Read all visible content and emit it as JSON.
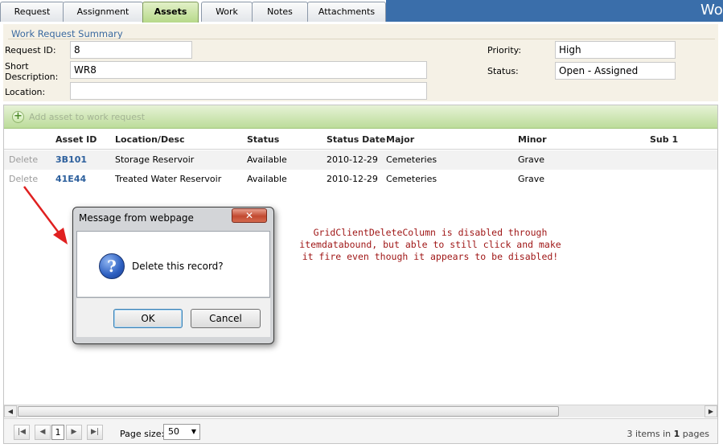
{
  "app": {
    "title": "Work Request"
  },
  "tabs": [
    {
      "label": "Request",
      "active": false
    },
    {
      "label": "Assignment",
      "active": false
    },
    {
      "label": "Assets",
      "active": true
    },
    {
      "label": "Work",
      "active": false
    },
    {
      "label": "Notes",
      "active": false
    },
    {
      "label": "Attachments",
      "active": false
    }
  ],
  "summary": {
    "legend": "Work Request Summary",
    "request_id_label": "Request ID:",
    "request_id_value": "8",
    "short_desc_label_1": "Short",
    "short_desc_label_2": "Description:",
    "short_desc_value": "WR8",
    "location_label": "Location:",
    "location_value": "",
    "priority_label": "Priority:",
    "priority_value": "High",
    "status_label": "Status:",
    "status_value": "Open - Assigned"
  },
  "grid": {
    "add_label": "Add asset to work request",
    "columns": [
      "Asset ID",
      "Location/Desc",
      "Status",
      "Status Date",
      "Major",
      "Minor",
      "Sub 1"
    ],
    "rows": [
      {
        "delete": "Delete",
        "asset_id": "3B101",
        "location": "Storage Reservoir",
        "status": "Available",
        "status_date": "2010-12-29",
        "major": "Cemeteries",
        "minor": "Grave"
      },
      {
        "delete": "Delete",
        "asset_id": "41E44",
        "location": "Treated Water Reservoir",
        "status": "Available",
        "status_date": "2010-12-29",
        "major": "Cemeteries",
        "minor": "Grave"
      }
    ]
  },
  "pager": {
    "current_page": "1",
    "page_size_label": "Page size:",
    "page_size_value": "50",
    "items_count": "3",
    "items_text": " items in ",
    "pages_count": "1",
    "pages_text": " pages"
  },
  "annotation": {
    "line1": "GridClientDeleteColumn is disabled through",
    "line2": "itemdatabound, but able to still click and make",
    "line3": "it fire even though it appears to be disabled!"
  },
  "dialog": {
    "title": "Message from webpage",
    "message": "Delete this record?",
    "ok_label": "OK",
    "cancel_label": "Cancel",
    "close_glyph": "✕"
  },
  "colors": {
    "header_blue": "#3a6eaa",
    "active_tab": "#b7d98a",
    "annotation_red": "#a01818",
    "link_blue": "#2c5f9c"
  }
}
